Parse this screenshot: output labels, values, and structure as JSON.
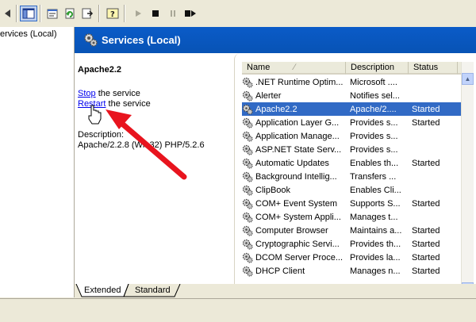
{
  "toolbar": {
    "buttons": [
      {
        "name": "back-arrow-icon"
      },
      {
        "name": "show-hide-tree-icon"
      },
      {
        "name": "properties-icon"
      },
      {
        "name": "refresh-icon"
      },
      {
        "name": "export-list-icon"
      },
      {
        "name": "help-icon"
      },
      {
        "name": "start-service-icon"
      },
      {
        "name": "stop-service-icon"
      },
      {
        "name": "pause-service-icon"
      },
      {
        "name": "restart-service-icon"
      }
    ]
  },
  "tree": {
    "selected_item": "ervices (Local)"
  },
  "header": {
    "title": "Services (Local)"
  },
  "details": {
    "service_name": "Apache2.2",
    "stop_link": "Stop",
    "stop_suffix": " the service",
    "restart_link": "Restart",
    "restart_suffix": " the service",
    "description_label": "Description:",
    "description_text": "Apache/2.2.8 (Win32) PHP/5.2.6"
  },
  "list": {
    "columns": {
      "name": "Name",
      "description": "Description",
      "status": "Status"
    },
    "rows": [
      {
        "name": ".NET Runtime Optim...",
        "description": "Microsoft ....",
        "status": ""
      },
      {
        "name": "Alerter",
        "description": "Notifies sel...",
        "status": ""
      },
      {
        "name": "Apache2.2",
        "description": "Apache/2....",
        "status": "Started",
        "selected": true
      },
      {
        "name": "Application Layer G...",
        "description": "Provides s...",
        "status": "Started"
      },
      {
        "name": "Application Manage...",
        "description": "Provides s...",
        "status": ""
      },
      {
        "name": "ASP.NET State Serv...",
        "description": "Provides s...",
        "status": ""
      },
      {
        "name": "Automatic Updates",
        "description": "Enables th...",
        "status": "Started"
      },
      {
        "name": "Background Intellig...",
        "description": "Transfers ...",
        "status": ""
      },
      {
        "name": "ClipBook",
        "description": "Enables Cli...",
        "status": ""
      },
      {
        "name": "COM+ Event System",
        "description": "Supports S...",
        "status": "Started"
      },
      {
        "name": "COM+ System Appli...",
        "description": "Manages t...",
        "status": ""
      },
      {
        "name": "Computer Browser",
        "description": "Maintains a...",
        "status": "Started"
      },
      {
        "name": "Cryptographic Servi...",
        "description": "Provides th...",
        "status": "Started"
      },
      {
        "name": "DCOM Server Proce...",
        "description": "Provides la...",
        "status": "Started"
      },
      {
        "name": "DHCP Client",
        "description": "Manages n...",
        "status": "Started"
      }
    ]
  },
  "tabs": [
    {
      "label": "Extended",
      "active": true
    },
    {
      "label": "Standard",
      "active": false
    }
  ],
  "colors": {
    "header_blue": "#0A5BC8",
    "selection_blue": "#316AC5",
    "annotation_arrow": "#E8141E"
  }
}
